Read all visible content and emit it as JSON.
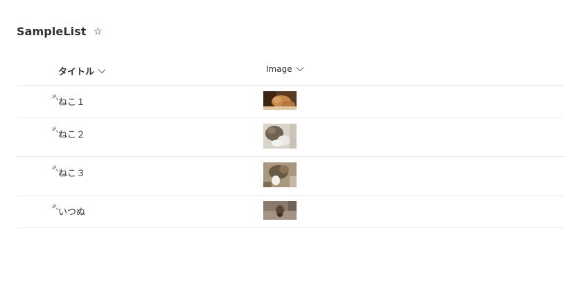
{
  "list": {
    "title": "SampleList",
    "favorite_icon": "star-outline-icon"
  },
  "columns": [
    {
      "label": "タイトル",
      "icon": "chevron-down-icon"
    },
    {
      "label": "Image",
      "icon": "chevron-down-icon"
    }
  ],
  "rows": [
    {
      "title": "ねこ１",
      "image": "cat-photo-thumbnail",
      "new_indicator_icon": "new-item-icon"
    },
    {
      "title": "ねこ２",
      "image": "cat-photo-thumbnail",
      "new_indicator_icon": "new-item-icon"
    },
    {
      "title": "ねこ３",
      "image": "cat-photo-thumbnail",
      "new_indicator_icon": "new-item-icon"
    },
    {
      "title": "いつぬ",
      "image": "dog-photo-thumbnail",
      "new_indicator_icon": "new-item-icon"
    }
  ],
  "colors": {
    "text": "#323130",
    "divider": "#edebe9",
    "new_indicator": "#4a7886"
  }
}
